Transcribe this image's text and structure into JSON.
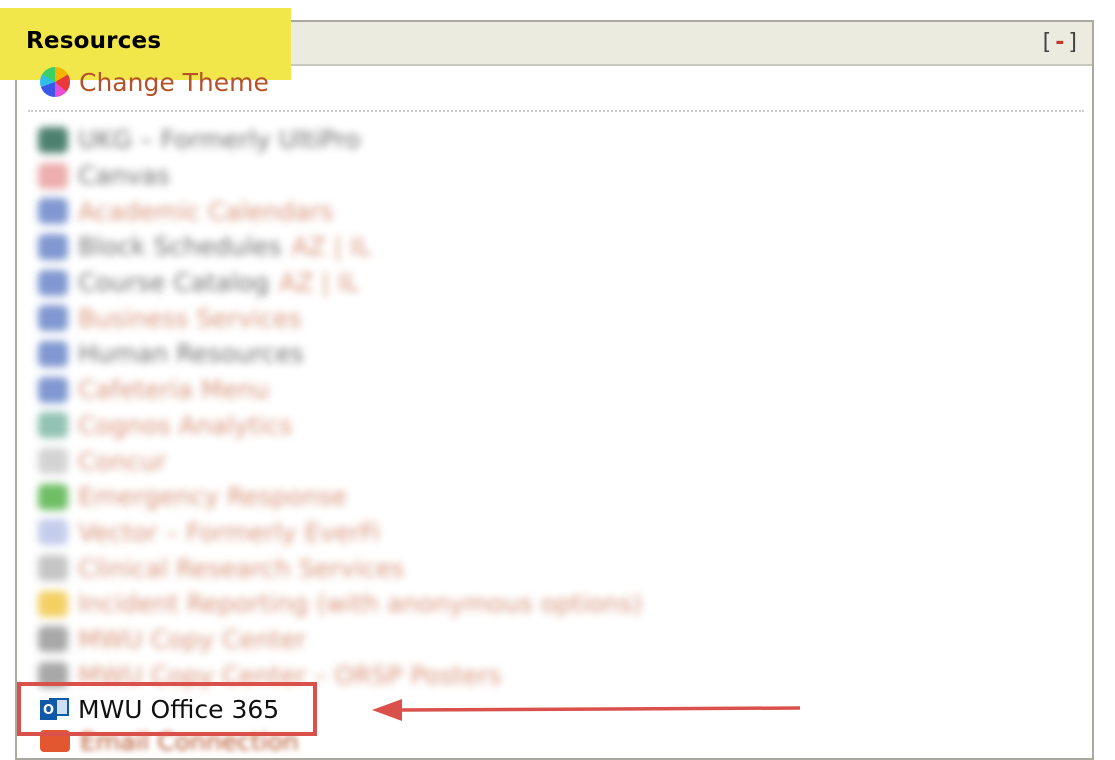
{
  "panel": {
    "title": "Resources",
    "collapse_open": "[",
    "collapse_label": "-",
    "collapse_close": "]"
  },
  "theme": {
    "label": "Change Theme",
    "icon": "color-wheel-icon"
  },
  "blurred_items": [
    {
      "label": "UKG – Formerly UltiPro",
      "style": "plain",
      "icon_color": "#2e6b57"
    },
    {
      "label": "Canvas",
      "style": "plain",
      "icon_color": "#e9a0a0"
    },
    {
      "label": "Academic Calendars",
      "style": "link",
      "icon_color": "#6a86c9"
    },
    {
      "label": "Block Schedules",
      "extra": "AZ | IL",
      "style": "plain",
      "icon_color": "#6a86c9"
    },
    {
      "label": "Course Catalog",
      "extra": "AZ | IL",
      "style": "plain",
      "icon_color": "#6a86c9"
    },
    {
      "label": "Business Services",
      "style": "link",
      "icon_color": "#6a86c9"
    },
    {
      "label": "Human Resources",
      "style": "plain",
      "icon_color": "#6a86c9"
    },
    {
      "label": "Cafeteria Menu",
      "style": "link",
      "icon_color": "#6a86c9"
    },
    {
      "label": "Cognos Analytics",
      "style": "link",
      "icon_color": "#7fb8a6"
    },
    {
      "label": "Concur",
      "style": "link",
      "icon_color": "#cccccc"
    },
    {
      "label": "Emergency Response",
      "style": "link",
      "icon_color": "#56b34a"
    },
    {
      "label": "Vector – Formerly EverFi",
      "style": "link",
      "icon_color": "#b9c5e8"
    },
    {
      "label": "Clinical Research Services",
      "style": "link",
      "icon_color": "#bbbbbb"
    },
    {
      "label": "Incident Reporting (with anonymous options)",
      "style": "link",
      "icon_color": "#f1c84a"
    },
    {
      "label": "MWU Copy Center",
      "style": "link",
      "icon_color": "#999999"
    },
    {
      "label": "MWU Copy Center – ORSP Posters",
      "style": "link",
      "icon_color": "#999999"
    }
  ],
  "office365": {
    "label": "MWU Office 365",
    "icon": "outlook-icon",
    "icon_letter": "O"
  },
  "partial_next": {
    "label": "Email Connection",
    "icon": "email-icon"
  },
  "colors": {
    "link": "#b4532a",
    "highlight": "#f1e64a",
    "callout": "#d9514a",
    "header_bg": "#ebebe0"
  }
}
